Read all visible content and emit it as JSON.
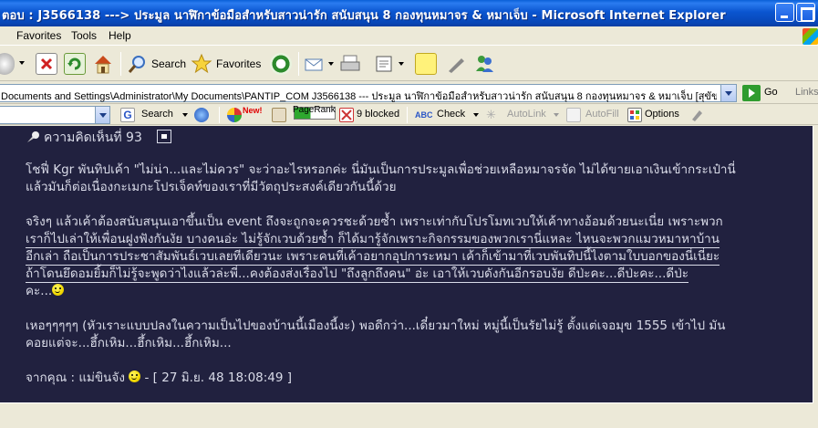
{
  "window": {
    "title": "ตอบ : J3566138 ---> ประมูล นาฬิกาข้อมือสำหรับสาวน่ารัก สนับสนุน 8 กองทุนหมาจร & หมาเจ็บ  - Microsoft Internet Explorer"
  },
  "menu": {
    "items": [
      "Favorites",
      "Tools",
      "Help"
    ]
  },
  "toolbar": {
    "search_label": "Search",
    "favorites_label": "Favorites"
  },
  "address": {
    "value": "Documents and Settings\\Administrator\\My Documents\\PANTIP_COM  J3566138 --- ประมูล นาฬิกาข้อมือสำหรับสาวน่ารัก สนับสนุน 8 กองทุนหมาจร & หมาเจ็บ [สุขัข].htm",
    "go_label": "Go",
    "links_label": "Links"
  },
  "google_toolbar": {
    "search_label": "Search",
    "new_badge": "New!",
    "pagerank_label": "PageRank",
    "blocked_label": "9 blocked",
    "check_label": "Check",
    "autolink_label": "AutoLink",
    "autofill_label": "AutoFill",
    "options_label": "Options"
  },
  "comment": {
    "header": "ความคิดเห็นที่ 93",
    "p1_line1": "โชฟี่ Kgr พันทิปเค้า \"ไม่น่า...และไม่ควร\" จะว่าอะไรหรอกค่ะ นี่มันเป็นการประมูลเพื่อช่วยเหลือหมาจรจัด ไม่ได้ขายเอาเงินเข้ากระเป๋านี่",
    "p1_line2": "แล้วมันก็ต่อเนื่องกะเมกะโปรเจ็คท์ของเราที่มีวัตถุประสงค์เดียวกันนี้ด้วย",
    "p2_line1": "จริงๆ แล้วเค้าต้องสนับสนุนเอาขึ้นเป็น event ถึงจะถูกจะควรชะด้วยซ้ำ เพราะเท่ากับโปรโมทเวบให้เค้าทางอ้อมด้วยนะเนี่ย เพราะพวก",
    "p2_line2": "เราก็ไปเล่าให้เพื่อนฝูงฟังกันงัย บางคนอ่ะ ไม่รู้จักเวบด้วยซ้ำ ก็ได้มารู้จักเพราะกิจกรรมของพวกเรานี่แหละ ไหนจะพวกแมวหมาหาบ้าน",
    "p2_line3": "อีกเล่า ถือเป็นการประชาสัมพันธ์เวบเลยทีเดียวนะ เพราะคนที่เค้าอยากอุปการะหมา เค้าก็เข้ามาที่เวบพันทิปนี้ไงตามใบบอกของนี่เนี่ยะ",
    "p2_line4": "ถ้าโดนยึดอมยิ้มก็ไม่รู้จะพูดว่าไงแล้วล่ะพี่...คงต้องส่งเรื่องไป \"ถึงลูกถึงคน\" อ่ะ เอาให้เวบดังกันอีกรอบงัย ดีป่ะคะ...ดีป่ะคะ...ดีป่ะ",
    "p2_line5": "คะ...",
    "p3_line1": "เหอๆๆๆๆๆ (หัวเราะแบบปลงในความเป็นไปของบ้านนี้เมืองนี้งะ) พอดีกว่า...เดี๋ยวมาใหม่ หมู่นี้เป็นรัยไม่รู้ ตั้งแต่เจอมุข 1555 เข้าไป มัน",
    "p3_line2": "คอยแต่จะ...ฮึ้กเหิม...ฮึ้กเหิม...ฮึ้กเหิม...",
    "from_label": "จากคุณ : แม่ขินจัง",
    "date_text": "- [ 27 มิ.ย. 48 18:08:49 ]"
  },
  "colors": {
    "content_bg": "#21213f",
    "content_text": "#d9dbe8",
    "titlebar": "#0a55d0"
  }
}
